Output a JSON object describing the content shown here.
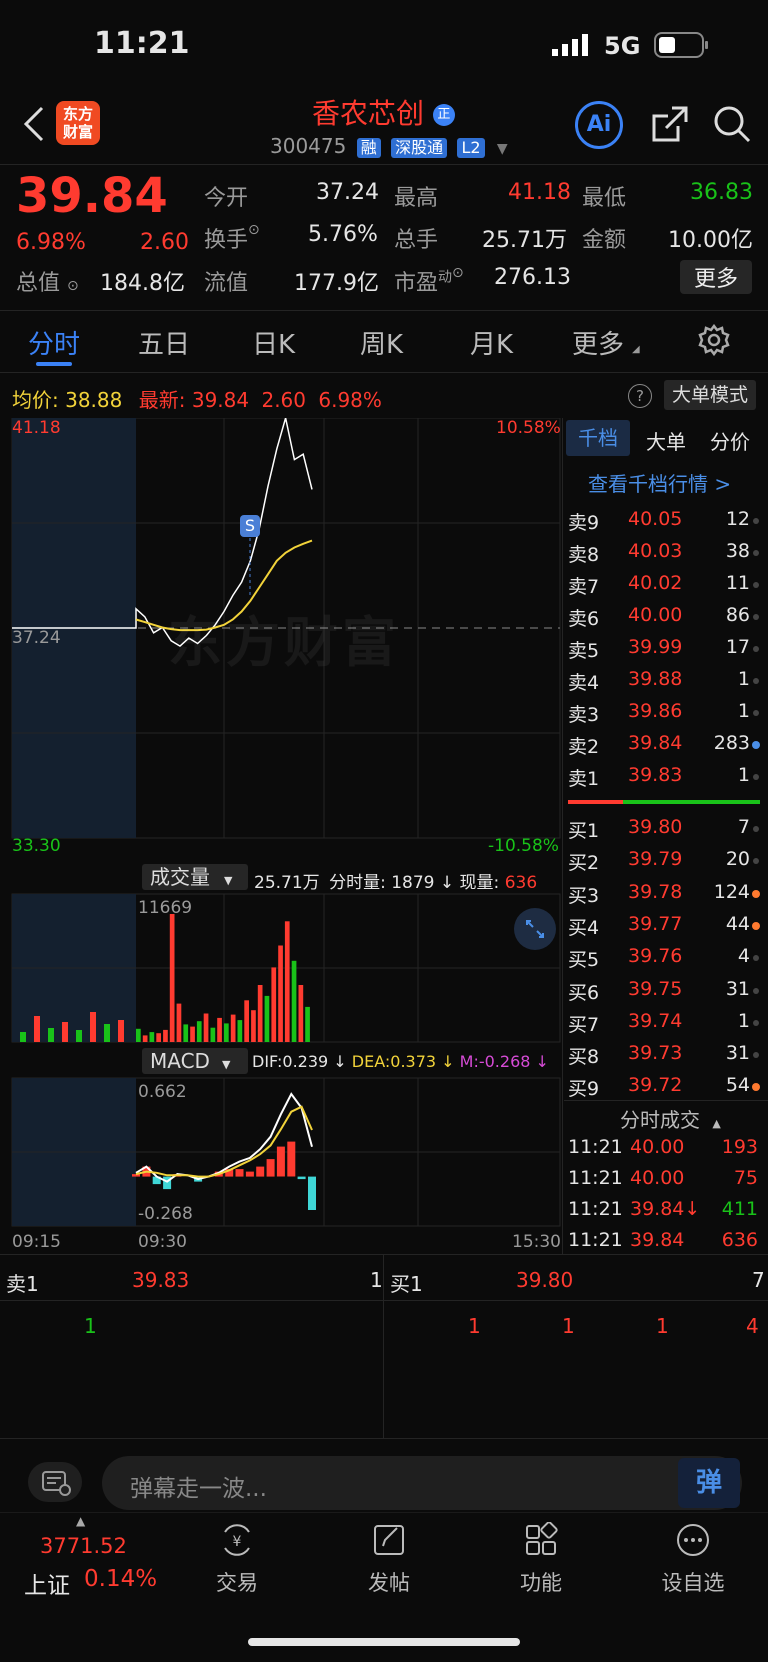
{
  "status_bar": {
    "time": "11:21",
    "network": "5G"
  },
  "header": {
    "logo_line1": "东方",
    "logo_line2": "财富",
    "stock_name": "香农芯创",
    "name_badge": "正",
    "stock_code": "300475",
    "tags": [
      "融",
      "深股通",
      "L2"
    ],
    "ai_label": "Ai"
  },
  "quote": {
    "price": "39.84",
    "change_pct": "6.98%",
    "change": "2.60",
    "total_value_label": "总值",
    "total_value": "184.8亿",
    "open_label": "今开",
    "open": "37.24",
    "high_label": "最高",
    "high": "41.18",
    "low_label": "最低",
    "low": "36.83",
    "turnover_label": "换手",
    "turnover": "5.76%",
    "volume_label": "总手",
    "volume": "25.71万",
    "amount_label": "金额",
    "amount": "10.00亿",
    "float_value_label": "流值",
    "float_value": "177.9亿",
    "pe_label": "市盈",
    "pe_sup": "动",
    "pe": "276.13",
    "more_button": "更多"
  },
  "tabs": [
    "分时",
    "五日",
    "日K",
    "周K",
    "月K",
    "更多"
  ],
  "info_line": {
    "avg_label": "均价:",
    "avg": "38.88",
    "latest_label": "最新:",
    "latest": "39.84",
    "latest_change": "2.60",
    "latest_pct": "6.98%",
    "help": "?",
    "mode_button": "大单模式"
  },
  "chart_labels": {
    "price_top": "41.18",
    "price_base": "37.24",
    "price_bottom": "33.30",
    "pct_top": "10.58%",
    "pct_bottom": "-10.58%",
    "signal": "S",
    "watermark": "东方财富",
    "volume_selector": "成交量",
    "volume_total": "25.71万",
    "volume_period_label": "分时量:",
    "volume_period": "1879",
    "volume_now_label": "现量:",
    "volume_now": "636",
    "volume_max": "11669",
    "macd_selector": "MACD",
    "dif": "DIF:0.239",
    "dea": "DEA:0.373",
    "m": "M:-0.268",
    "macd_max": "0.662",
    "macd_min": "-0.268",
    "time_start": "09:15",
    "time_open": "09:30",
    "time_end": "15:30"
  },
  "chart_data": [
    {
      "type": "line",
      "title": "分时",
      "x_labels": [
        "09:15",
        "09:30",
        "15:30"
      ],
      "ylim": [
        33.3,
        41.18
      ],
      "baseline": 37.24,
      "series": [
        {
          "name": "最新",
          "color": "#ffffff",
          "values": [
            37.24,
            37.24,
            37.24,
            37.24,
            37.24,
            37.6,
            37.45,
            37.15,
            37.25,
            37.0,
            36.9,
            37.05,
            36.95,
            37.1,
            37.3,
            37.55,
            37.85,
            38.1,
            38.5,
            39.1,
            39.9,
            40.6,
            41.18,
            40.4,
            40.5,
            39.84
          ]
        },
        {
          "name": "均价",
          "color": "#f2d33a",
          "values": [
            null,
            null,
            null,
            null,
            null,
            37.4,
            37.35,
            37.3,
            37.25,
            37.22,
            37.2,
            37.2,
            37.2,
            37.21,
            37.25,
            37.3,
            37.4,
            37.55,
            37.75,
            38.0,
            38.25,
            38.5,
            38.65,
            38.75,
            38.82,
            38.88
          ]
        }
      ]
    },
    {
      "type": "bar",
      "title": "成交量",
      "ylim": [
        0,
        11669
      ],
      "values": [
        1200,
        600,
        900,
        800,
        1100,
        11669,
        3500,
        1600,
        1400,
        1900,
        2600,
        1300,
        2200,
        1700,
        2500,
        2000,
        3800,
        2900,
        5200,
        4200,
        6800,
        8800,
        11000,
        7400,
        5200,
        3200
      ],
      "colors": [
        "g",
        "r",
        "g",
        "r",
        "r",
        "r",
        "r",
        "g",
        "r",
        "g",
        "r",
        "g",
        "r",
        "g",
        "r",
        "g",
        "r",
        "r",
        "r",
        "g",
        "r",
        "r",
        "r",
        "g",
        "r",
        "g"
      ]
    },
    {
      "type": "line",
      "title": "MACD",
      "ylim": [
        -0.268,
        0.662
      ],
      "series": [
        {
          "name": "DIF",
          "color": "#ffffff",
          "values": [
            0.03,
            0.08,
            0.0,
            -0.04,
            0.02,
            0.01,
            -0.02,
            0.0,
            0.03,
            0.08,
            0.12,
            0.15,
            0.22,
            0.32,
            0.5,
            0.662,
            0.55,
            0.239
          ]
        },
        {
          "name": "DEA",
          "color": "#f2d33a",
          "values": [
            0.02,
            0.04,
            0.03,
            0.01,
            0.01,
            0.01,
            0.0,
            0.0,
            0.02,
            0.05,
            0.09,
            0.13,
            0.18,
            0.25,
            0.38,
            0.52,
            0.56,
            0.373
          ]
        },
        {
          "name": "M",
          "color": "#d64bd6",
          "values": [
            0.02,
            0.08,
            -0.06,
            -0.1,
            0.02,
            0.0,
            -0.04,
            0.0,
            0.04,
            0.06,
            0.06,
            0.04,
            0.08,
            0.14,
            0.24,
            0.28,
            -0.02,
            -0.268
          ]
        }
      ]
    }
  ],
  "side_tabs": [
    "千档",
    "大单",
    "分价"
  ],
  "side_link": "查看千档行情 >",
  "asks": [
    {
      "label": "卖9",
      "price": "40.05",
      "qty": "12"
    },
    {
      "label": "卖8",
      "price": "40.03",
      "qty": "38"
    },
    {
      "label": "卖7",
      "price": "40.02",
      "qty": "11"
    },
    {
      "label": "卖6",
      "price": "40.00",
      "qty": "86"
    },
    {
      "label": "卖5",
      "price": "39.99",
      "qty": "17"
    },
    {
      "label": "卖4",
      "price": "39.88",
      "qty": "1"
    },
    {
      "label": "卖3",
      "price": "39.86",
      "qty": "1"
    },
    {
      "label": "卖2",
      "price": "39.84",
      "qty": "283"
    },
    {
      "label": "卖1",
      "price": "39.83",
      "qty": "1"
    }
  ],
  "bids": [
    {
      "label": "买1",
      "price": "39.80",
      "qty": "7"
    },
    {
      "label": "买2",
      "price": "39.79",
      "qty": "20"
    },
    {
      "label": "买3",
      "price": "39.78",
      "qty": "124"
    },
    {
      "label": "买4",
      "price": "39.77",
      "qty": "44"
    },
    {
      "label": "买5",
      "price": "39.76",
      "qty": "4"
    },
    {
      "label": "买6",
      "price": "39.75",
      "qty": "31"
    },
    {
      "label": "买7",
      "price": "39.74",
      "qty": "1"
    },
    {
      "label": "买8",
      "price": "39.73",
      "qty": "31"
    },
    {
      "label": "买9",
      "price": "39.72",
      "qty": "54"
    }
  ],
  "trades_title": "分时成交",
  "trades": [
    {
      "time": "11:21",
      "price": "40.00",
      "qty": "193",
      "dir": "r"
    },
    {
      "time": "11:21",
      "price": "40.00",
      "qty": "75",
      "dir": "r"
    },
    {
      "time": "11:21",
      "price": "39.84↓",
      "qty": "411",
      "dir": "g"
    },
    {
      "time": "11:21",
      "price": "39.84",
      "qty": "636",
      "dir": "r"
    }
  ],
  "bottom_queue": {
    "sell_label": "卖1",
    "sell_price": "39.83",
    "sell_qty": "1",
    "buy_label": "买1",
    "buy_price": "39.80",
    "buy_qty": "7",
    "sell_orders": [
      "1"
    ],
    "buy_orders": [
      "1",
      "1",
      "1",
      "4"
    ]
  },
  "danmaku": {
    "placeholder": "弹幕走一波...",
    "button": "弹"
  },
  "bottom_nav": {
    "index_value": "3771.52",
    "index_name": "上证",
    "index_pct": "0.14%",
    "items": [
      "交易",
      "发帖",
      "功能",
      "设自选"
    ]
  }
}
